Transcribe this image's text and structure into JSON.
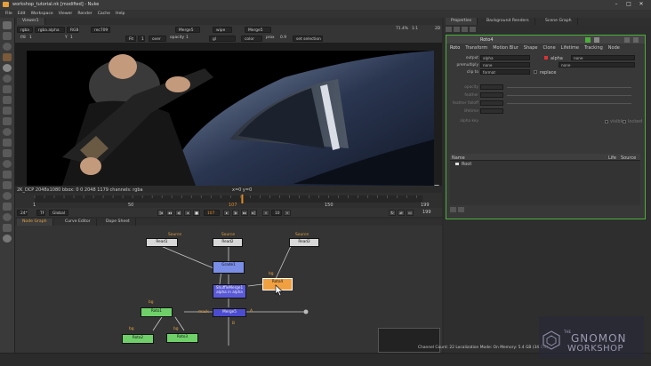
{
  "window": {
    "title": "workshop_tutorial.nk [modified] - Nuke",
    "controls": [
      "–",
      "□",
      "✕"
    ]
  },
  "menu": [
    "File",
    "Edit",
    "Workspace",
    "Viewer",
    "Render",
    "Cache",
    "Help"
  ],
  "viewer": {
    "tab": "Viewer1",
    "bar1": {
      "channels": "rgba",
      "layer": "rgba.alpha",
      "colorspace": "RGB",
      "lut": "rec709",
      "a_input": "Merge5",
      "a_mode": "wipe",
      "b_input": "Merge5"
    },
    "bar2": {
      "fstop_label": "f/8",
      "fstop_val": "1",
      "y_label": "Y",
      "y_val": "1",
      "zoom_val": "Fit",
      "proxy_val": "1",
      "over_val": "over",
      "opacity_label": "opacity",
      "opacity_val": "1",
      "gl_val": "gl",
      "channel_val": "color",
      "prox_label": "prox",
      "prox_val": "0.9",
      "sel_val": "set selection"
    },
    "info": "2K_DCP 2048x1080  bbox: 0 0 2048 1179 channels: rgba",
    "coords": "x=0 y=0",
    "zoom_pct": "71.4%",
    "ratio": "1:1",
    "frame_count": "2D"
  },
  "timeline": {
    "ticks": [
      "1",
      "50",
      "100",
      "150",
      "199"
    ],
    "current": "107",
    "fps": "24*",
    "tf": "TF",
    "global": "Global",
    "end": "199",
    "step": "10"
  },
  "nodegraph_tabs": [
    "Node Graph",
    "Curve Editor",
    "Dope Sheet"
  ],
  "nodes": {
    "read1": "Read1",
    "read2": "Read2",
    "read3": "Read3",
    "grade": "Grade1",
    "shuffle": "ShuffleMerge1",
    "shuffle_sub": "alpha in alpha",
    "roto4": "Roto4",
    "roto1": "Roto1",
    "roto2": "Roto2",
    "roto3": "Roto3",
    "merge": "Merge5",
    "labels": {
      "src1": "Source",
      "src2": "Source",
      "src3": "Source",
      "bg1": "bg",
      "bg2": "bg",
      "bg3": "bg",
      "bg4": "bg",
      "mask": "mask",
      "a": "A",
      "b": "B"
    }
  },
  "right_tabs": [
    "Properties",
    "Background Renders",
    "Scene Graph"
  ],
  "roto": {
    "name": "Roto4",
    "tabs": [
      "Roto",
      "Transform",
      "Motion Blur",
      "Shape",
      "Clone",
      "Lifetime",
      "Tracking",
      "Node"
    ],
    "output_label": "output",
    "output_val": "alpha",
    "output_chk": "alpha",
    "output_none": "none",
    "premult_label": "premultiply",
    "premult_val": "none",
    "premult_none": "none",
    "clip_label": "clip to",
    "clip_val": "format",
    "replace": "replace",
    "opacity_label": "opacity",
    "feather_label": "feather",
    "feather_falloff_label": "feather falloff",
    "lifetime_label": "lifetime",
    "key_label": "alpha key",
    "visible": "visible",
    "locked": "locked",
    "columns": [
      "Name",
      "Life",
      "Source"
    ],
    "root": "Root"
  },
  "status": "Channel Count: 22  Localization Mode: On  Memory: 5.4 GB (34.1%)",
  "watermark": {
    "the": "THE",
    "brand": "GNOMON",
    "sub": "WORKSHOP"
  },
  "colors": {
    "read": "#d8d8d8",
    "grade": "#7a8ee8",
    "shuffle": "#5a5ad8",
    "roto": "#6fd06a",
    "roto_active": "#f0a040",
    "merge": "#4c4cd0",
    "panel_border": "#4caf3a",
    "timeline_marker": "#e08a20"
  }
}
